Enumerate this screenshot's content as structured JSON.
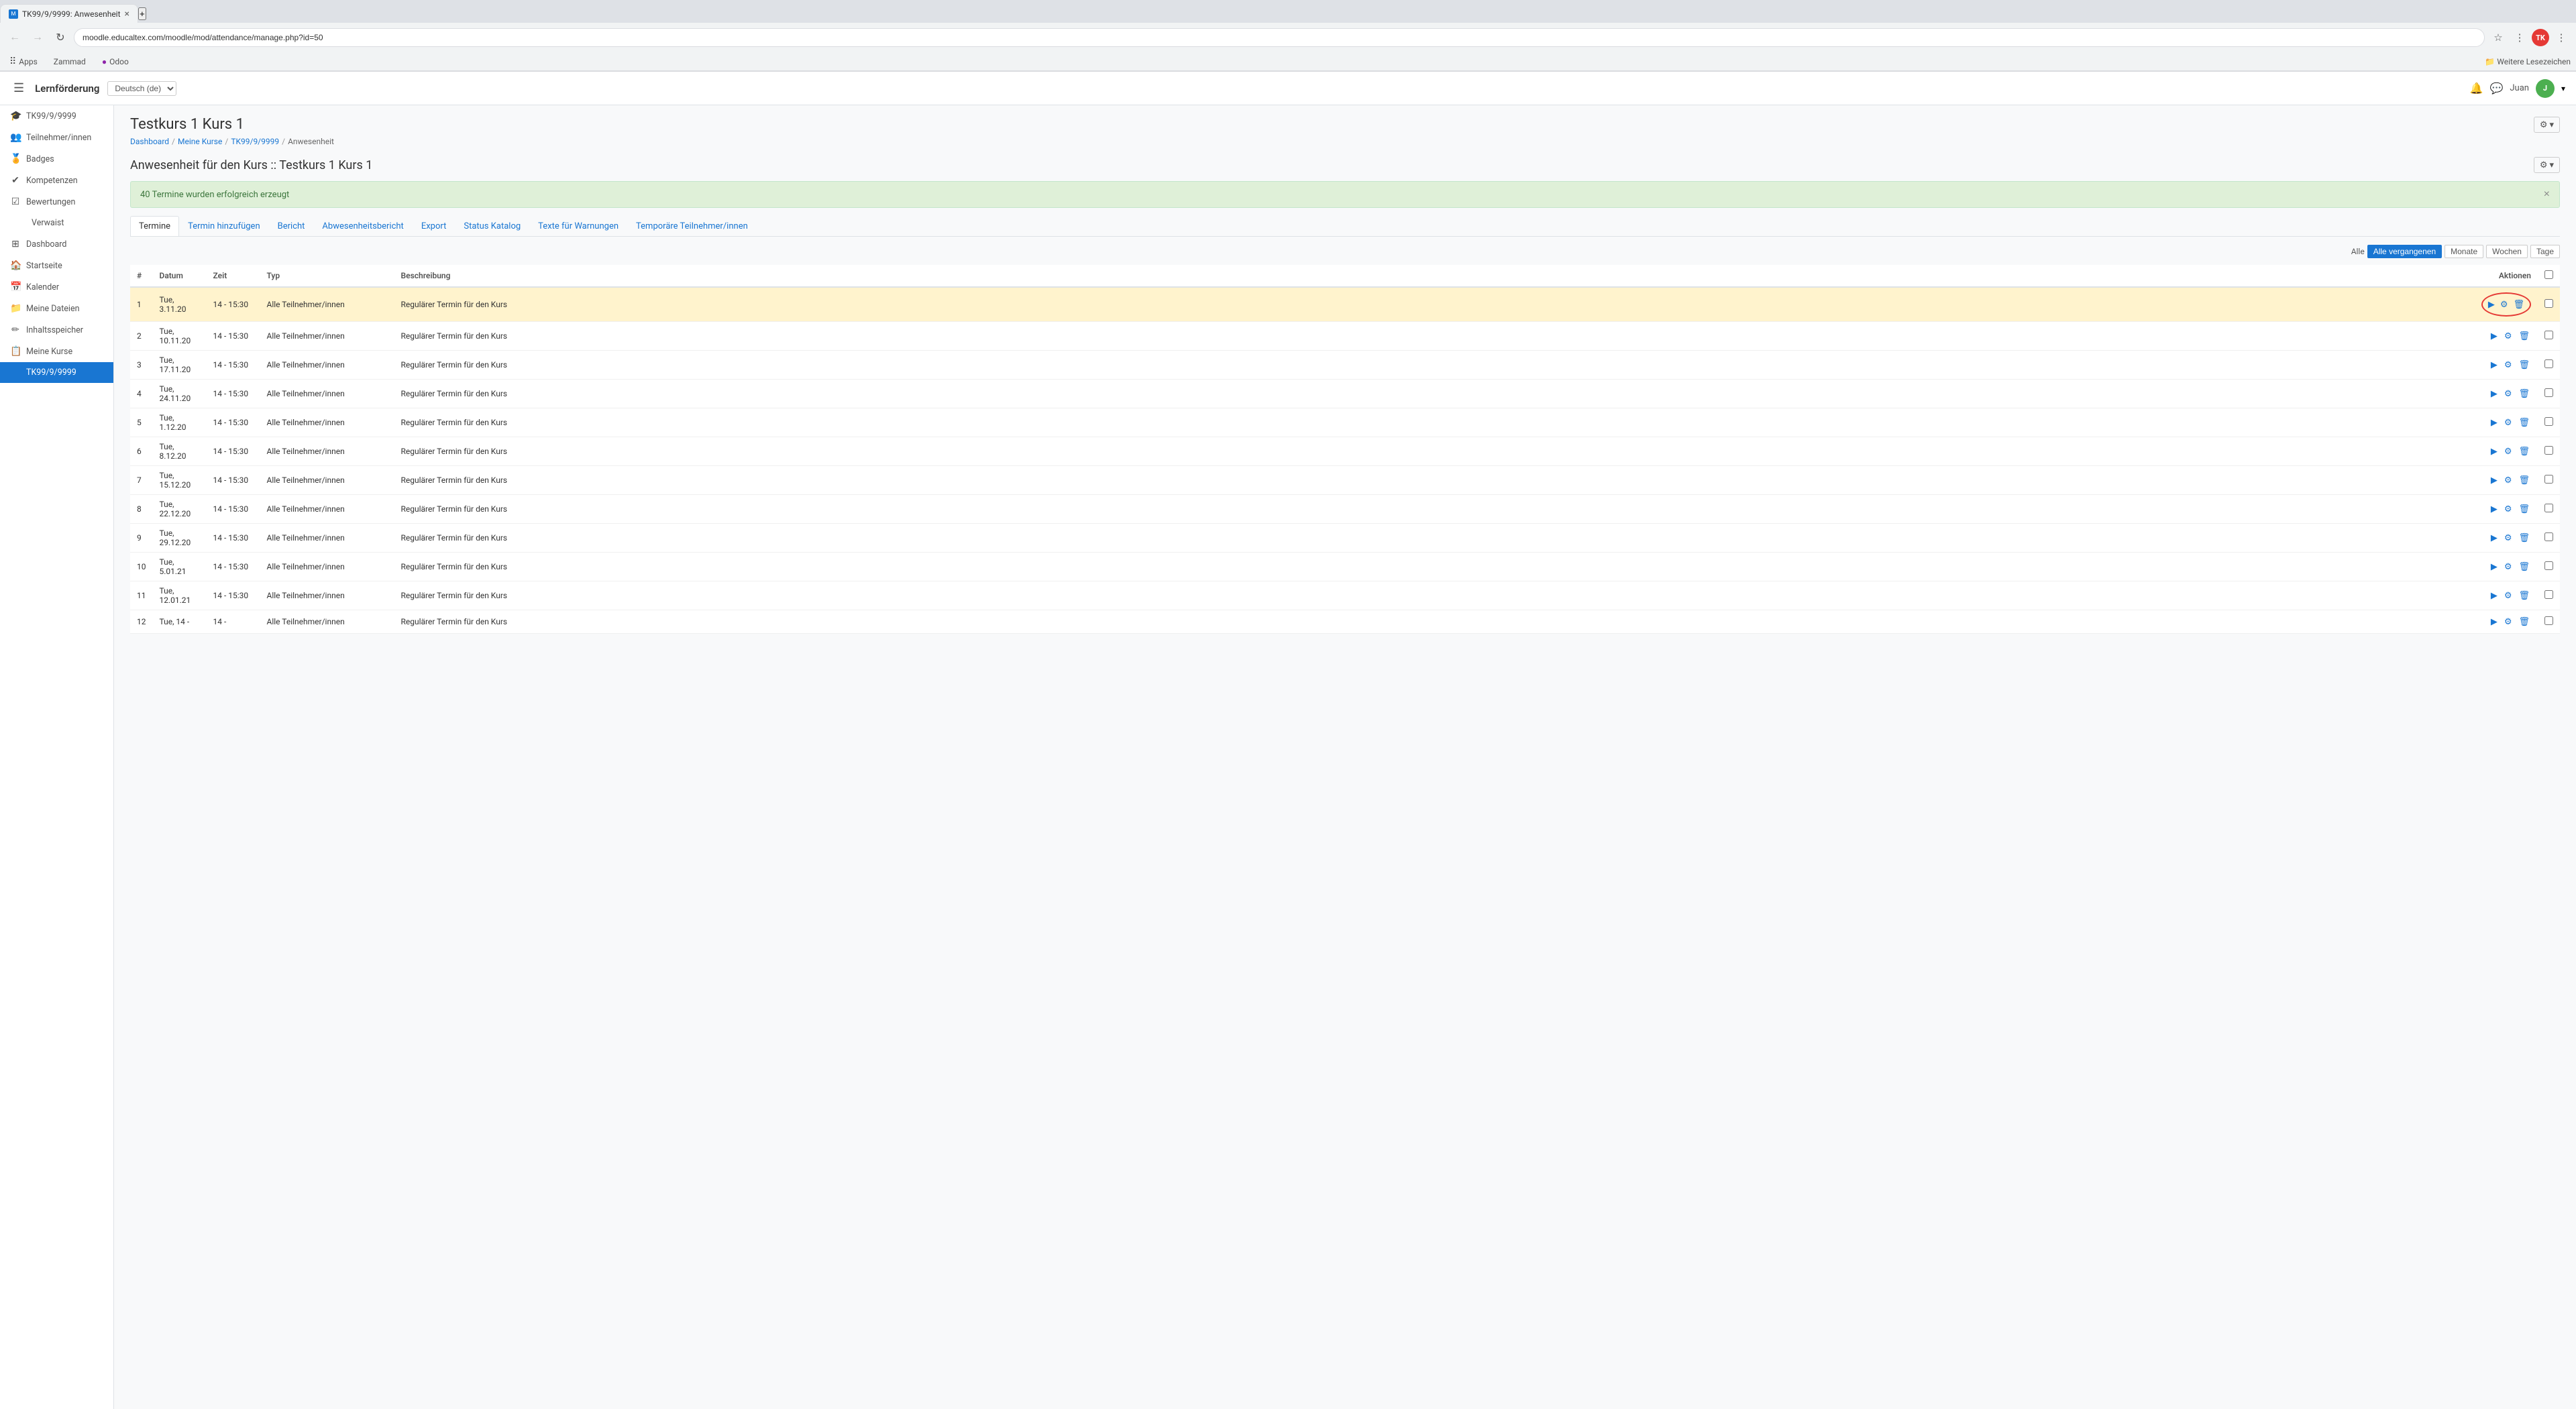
{
  "browser": {
    "tab_title": "TK99/9/9999: Anwesenheit",
    "url": "moodle.educaltex.com/moodle/mod/attendance/manage.php?id=50",
    "bookmarks": {
      "apps_label": "Apps",
      "items": [
        "Zammad",
        "Odoo"
      ],
      "folder_label": "Weitere Lesezeichen"
    }
  },
  "header": {
    "hamburger_label": "☰",
    "site_name": "Lernförderung",
    "lang": "Deutsch (de)",
    "notification_icon": "🔔",
    "message_icon": "💬",
    "user_name": "Juan",
    "user_initials": "J"
  },
  "sidebar": {
    "items": [
      {
        "id": "tk99",
        "label": "TK99/9/9999",
        "icon": "🎓",
        "active": false
      },
      {
        "id": "teilnehmer",
        "label": "Teilnehmer/innen",
        "icon": "👥",
        "active": false
      },
      {
        "id": "badges",
        "label": "Badges",
        "icon": "🏅",
        "active": false
      },
      {
        "id": "kompetenzen",
        "label": "Kompetenzen",
        "icon": "✔",
        "active": false
      },
      {
        "id": "bewertungen",
        "label": "Bewertungen",
        "icon": "☑",
        "active": false
      },
      {
        "id": "verwaist",
        "label": "Verwaist",
        "icon": "",
        "active": false,
        "sub": true
      },
      {
        "id": "dashboard",
        "label": "Dashboard",
        "icon": "⊞",
        "active": false
      },
      {
        "id": "startseite",
        "label": "Startseite",
        "icon": "🏠",
        "active": false
      },
      {
        "id": "kalender",
        "label": "Kalender",
        "icon": "📅",
        "active": false
      },
      {
        "id": "meine-dateien",
        "label": "Meine Dateien",
        "icon": "📁",
        "active": false
      },
      {
        "id": "inhaltsspeicher",
        "label": "Inhaltsspeicher",
        "icon": "✏",
        "active": false
      },
      {
        "id": "meine-kurse",
        "label": "Meine Kurse",
        "icon": "📋",
        "active": false
      },
      {
        "id": "tk99-active",
        "label": "TK99/9/9999",
        "icon": "",
        "active": true
      }
    ]
  },
  "page": {
    "title": "Testkurs 1 Kurs 1",
    "breadcrumb": [
      {
        "label": "Dashboard",
        "href": "#"
      },
      {
        "label": "Meine Kurse",
        "href": "#"
      },
      {
        "label": "TK99/9/9999",
        "href": "#"
      },
      {
        "label": "Anwesenheit",
        "href": null
      }
    ],
    "section_title": "Anwesenheit für den Kurs :: Testkurs 1 Kurs 1",
    "alert_message": "40 Termine wurden erfolgreich erzeugt",
    "tabs": [
      {
        "id": "termine",
        "label": "Termine",
        "active": true
      },
      {
        "id": "termin-hinzufugen",
        "label": "Termin hinzufügen",
        "active": false
      },
      {
        "id": "bericht",
        "label": "Bericht",
        "active": false
      },
      {
        "id": "abwesenheitsbericht",
        "label": "Abwesenheitsbericht",
        "active": false
      },
      {
        "id": "export",
        "label": "Export",
        "active": false
      },
      {
        "id": "status-katalog",
        "label": "Status Katalog",
        "active": false
      },
      {
        "id": "texte-warnungen",
        "label": "Texte für Warnungen",
        "active": false
      },
      {
        "id": "temporare-teilnehmer",
        "label": "Temporäre Teilnehmer/innen",
        "active": false
      }
    ],
    "filter": {
      "label": "Alle",
      "buttons": [
        {
          "id": "alle-vergangenen",
          "label": "Alle vergangenen",
          "active": true
        },
        {
          "id": "monate",
          "label": "Monate",
          "active": false
        },
        {
          "id": "wochen",
          "label": "Wochen",
          "active": false
        },
        {
          "id": "tage",
          "label": "Tage",
          "active": false
        }
      ]
    },
    "table": {
      "headers": [
        "#",
        "Datum",
        "Zeit",
        "Typ",
        "Beschreibung",
        "Aktionen",
        ""
      ],
      "rows": [
        {
          "num": 1,
          "datum": "Tue, 3.11.20",
          "zeit": "14 - 15:30",
          "typ": "Alle Teilnehmer/innen",
          "beschreibung": "Regulärer Termin für den Kurs",
          "highlighted": true
        },
        {
          "num": 2,
          "datum": "Tue, 10.11.20",
          "zeit": "14 - 15:30",
          "typ": "Alle Teilnehmer/innen",
          "beschreibung": "Regulärer Termin für den Kurs",
          "highlighted": false
        },
        {
          "num": 3,
          "datum": "Tue, 17.11.20",
          "zeit": "14 - 15:30",
          "typ": "Alle Teilnehmer/innen",
          "beschreibung": "Regulärer Termin für den Kurs",
          "highlighted": false
        },
        {
          "num": 4,
          "datum": "Tue, 24.11.20",
          "zeit": "14 - 15:30",
          "typ": "Alle Teilnehmer/innen",
          "beschreibung": "Regulärer Termin für den Kurs",
          "highlighted": false
        },
        {
          "num": 5,
          "datum": "Tue, 1.12.20",
          "zeit": "14 - 15:30",
          "typ": "Alle Teilnehmer/innen",
          "beschreibung": "Regulärer Termin für den Kurs",
          "highlighted": false
        },
        {
          "num": 6,
          "datum": "Tue, 8.12.20",
          "zeit": "14 - 15:30",
          "typ": "Alle Teilnehmer/innen",
          "beschreibung": "Regulärer Termin für den Kurs",
          "highlighted": false
        },
        {
          "num": 7,
          "datum": "Tue, 15.12.20",
          "zeit": "14 - 15:30",
          "typ": "Alle Teilnehmer/innen",
          "beschreibung": "Regulärer Termin für den Kurs",
          "highlighted": false
        },
        {
          "num": 8,
          "datum": "Tue, 22.12.20",
          "zeit": "14 - 15:30",
          "typ": "Alle Teilnehmer/innen",
          "beschreibung": "Regulärer Termin für den Kurs",
          "highlighted": false
        },
        {
          "num": 9,
          "datum": "Tue, 29.12.20",
          "zeit": "14 - 15:30",
          "typ": "Alle Teilnehmer/innen",
          "beschreibung": "Regulärer Termin für den Kurs",
          "highlighted": false
        },
        {
          "num": 10,
          "datum": "Tue, 5.01.21",
          "zeit": "14 - 15:30",
          "typ": "Alle Teilnehmer/innen",
          "beschreibung": "Regulärer Termin für den Kurs",
          "highlighted": false
        },
        {
          "num": 11,
          "datum": "Tue, 12.01.21",
          "zeit": "14 - 15:30",
          "typ": "Alle Teilnehmer/innen",
          "beschreibung": "Regulärer Termin für den Kurs",
          "highlighted": false
        },
        {
          "num": 12,
          "datum": "Tue, 14 -",
          "zeit": "14 -",
          "typ": "Alle Teilnehmer/innen",
          "beschreibung": "Regulärer Termin für den Kurs",
          "highlighted": false
        }
      ]
    }
  },
  "icons": {
    "play": "▶",
    "gear": "⚙",
    "trash": "🗑",
    "checkbox_empty": "□"
  }
}
